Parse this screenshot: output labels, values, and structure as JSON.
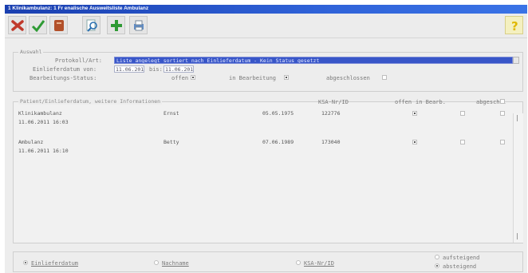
{
  "window": {
    "title": "1 Klinikambulanz: 1 Fr enalische Ausweitsliste Ambulanz"
  },
  "toolbar": {
    "buttons": [
      "cancel",
      "accept",
      "book",
      "search",
      "add",
      "print"
    ],
    "help_icon": "help-icon"
  },
  "auswahl": {
    "legend": "Auswahl",
    "protokoll_label": "Protokoll/Art:",
    "protokoll_value": "Liste angelegt sortiert nach Einlieferdatum - Kein Status gesetzt",
    "einlieferdatum_label": "Einlieferdatum von:",
    "date_from": "11.06.2011",
    "bis_label": "bis:",
    "date_to": "11.06.2011",
    "status_label": "Bearbeitungs-Status:",
    "status_offen": "offen",
    "status_in_bearbeitung": "in Bearbeitung",
    "status_abgeschlossen": "abgeschlossen"
  },
  "list": {
    "legend": "Patient/Einlieferdatum, weitere Informationen",
    "col_rsa": "KSA-Nr/ID",
    "col_flag1": "offen",
    "col_flag2": "in Bearb.",
    "col_flag3": "abgeschl.",
    "rows": [
      {
        "name": "Klinikambulanz",
        "datetime": "11.06.2011 16:03",
        "first": "Ernst",
        "dob": "05.05.1975",
        "id": "122776"
      },
      {
        "name": "Ambulanz",
        "datetime": "11.06.2011 16:10",
        "first": "Betty",
        "dob": "07.06.1989",
        "id": "173040"
      }
    ]
  },
  "sort": {
    "opt1": "Einlieferdatum",
    "opt2": "Nachname",
    "opt3": "KSA-Nr/ID",
    "asc": "aufsteigend",
    "desc": "absteigend"
  }
}
